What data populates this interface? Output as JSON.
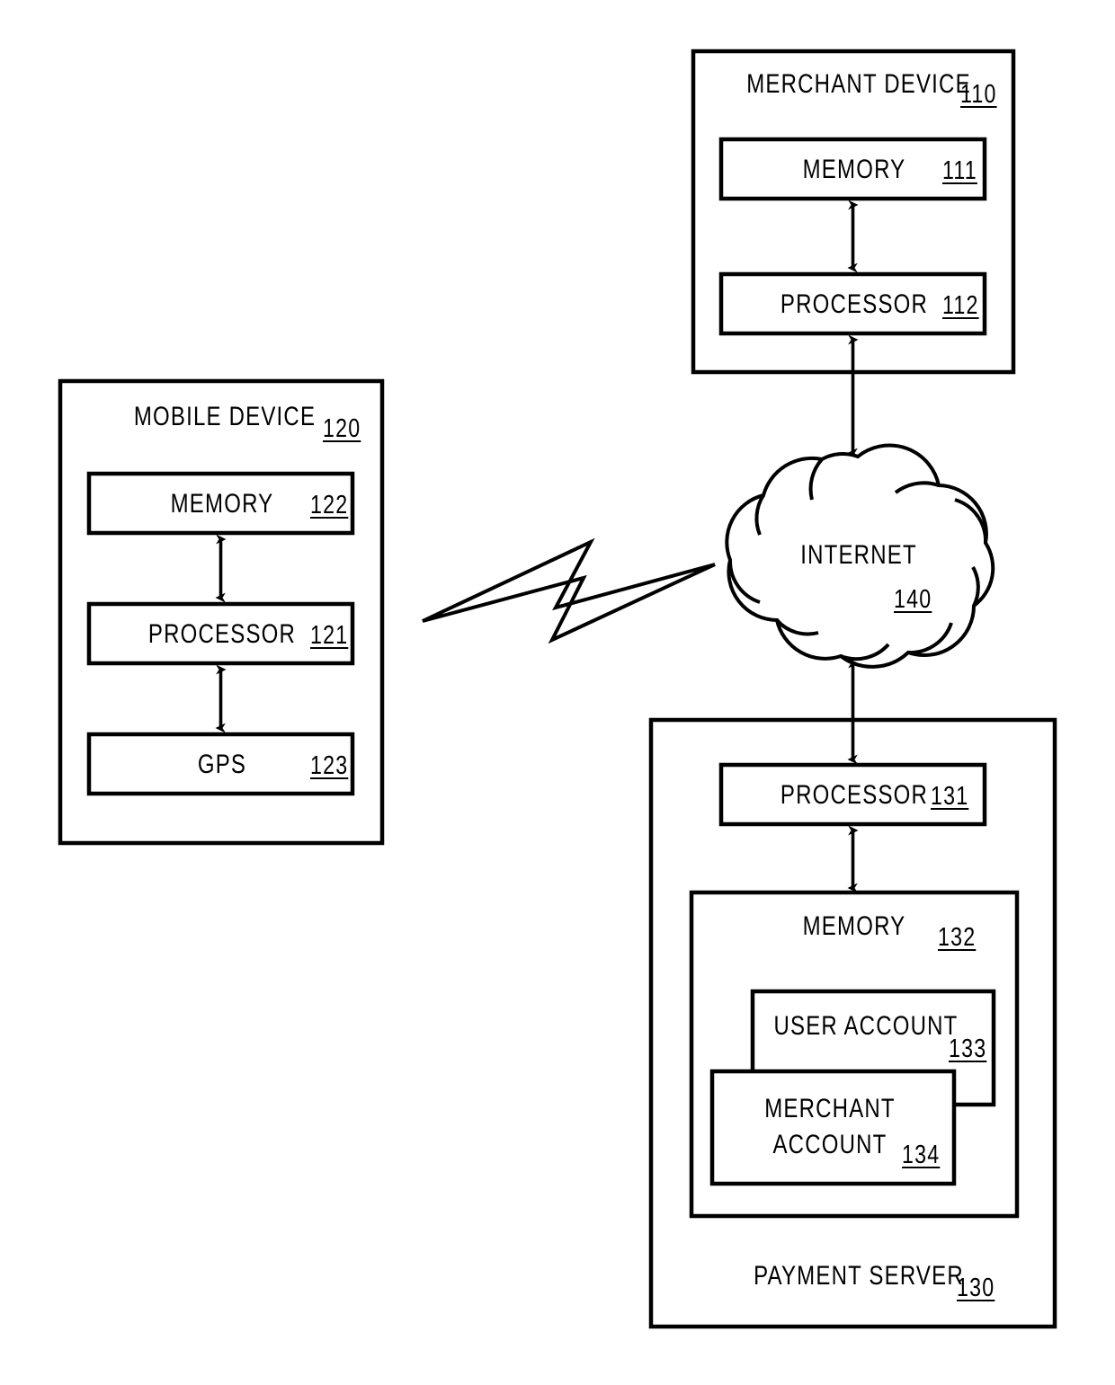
{
  "figure": {
    "type": "patent-block-diagram",
    "title": "Payment system architecture block diagram"
  },
  "nodes": {
    "merchant_device": {
      "label": "MERCHANT DEVICE",
      "ref": "110",
      "children": [
        {
          "label": "MEMORY",
          "ref": "111"
        },
        {
          "label": "PROCESSOR",
          "ref": "112"
        }
      ]
    },
    "mobile_device": {
      "label": "MOBILE DEVICE",
      "ref": "120",
      "children": [
        {
          "label": "MEMORY",
          "ref": "122"
        },
        {
          "label": "PROCESSOR",
          "ref": "121"
        },
        {
          "label": "GPS",
          "ref": "123"
        }
      ]
    },
    "internet": {
      "label": "INTERNET",
      "ref": "140"
    },
    "payment_server": {
      "label": "PAYMENT SERVER",
      "ref": "130",
      "children": [
        {
          "label": "PROCESSOR",
          "ref": "131"
        },
        {
          "label": "MEMORY",
          "ref": "132"
        },
        {
          "label": "USER ACCOUNT",
          "ref": "133"
        },
        {
          "label": "MERCHANT ACCOUNT",
          "ref": "134",
          "line1": "MERCHANT",
          "line2": "ACCOUNT"
        }
      ]
    }
  },
  "connectors": [
    {
      "name": "memory-111-to-processor-112",
      "style": "double-arrow"
    },
    {
      "name": "processor-112-to-internet",
      "style": "double-arrow"
    },
    {
      "name": "internet-to-processor-131",
      "style": "double-arrow"
    },
    {
      "name": "processor-131-to-memory-132",
      "style": "double-arrow"
    },
    {
      "name": "memory-122-to-processor-121",
      "style": "double-arrow"
    },
    {
      "name": "processor-121-to-gps-123",
      "style": "double-arrow"
    },
    {
      "name": "mobile-device-to-internet",
      "style": "wireless-lightning-bolt"
    }
  ],
  "colors": {
    "stroke": "#000000",
    "background": "#ffffff"
  }
}
